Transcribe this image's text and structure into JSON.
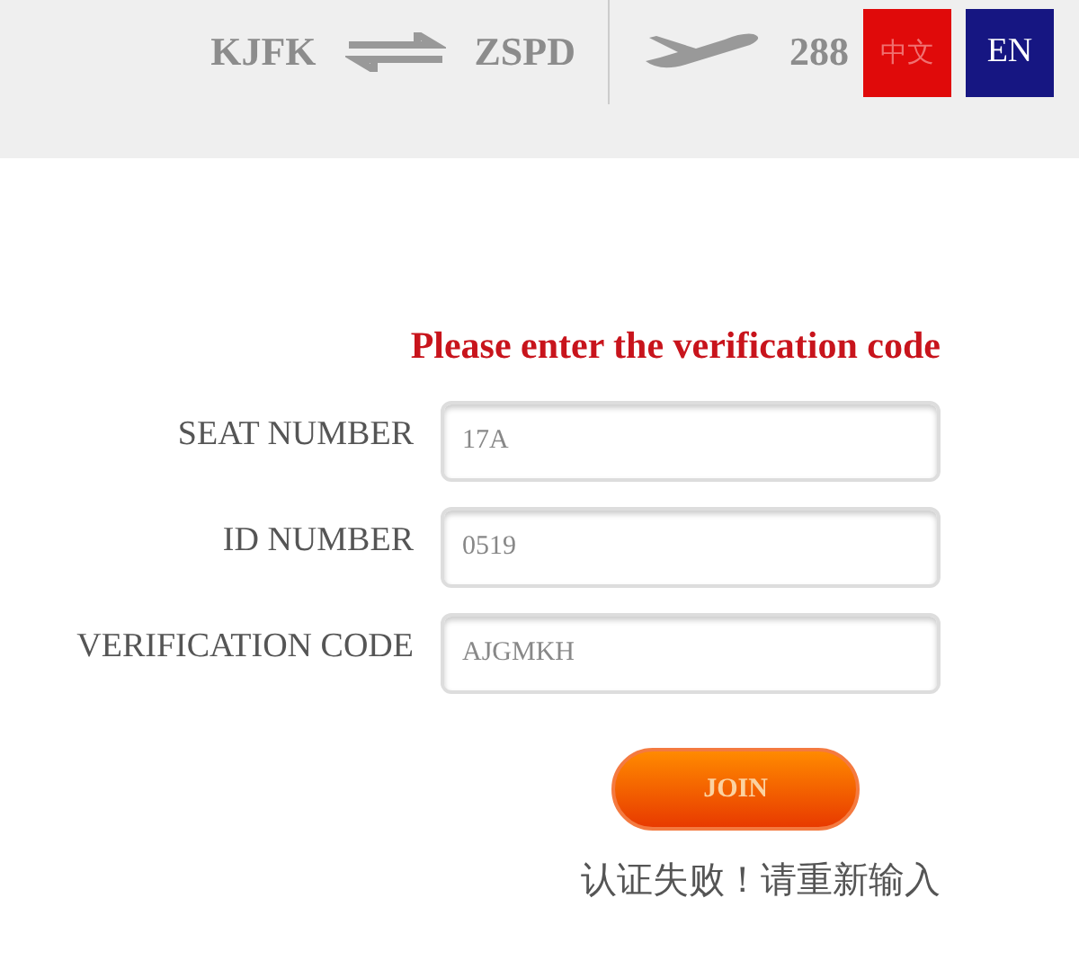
{
  "header": {
    "origin": "KJFK",
    "destination": "ZSPD",
    "flight": "288",
    "languages": [
      {
        "label": "中文",
        "color": "#e00a0a",
        "selected": false
      },
      {
        "label": "EN",
        "color": "#161682",
        "selected": true
      }
    ]
  },
  "form": {
    "title": "Please enter the verification code",
    "fields": [
      {
        "label": "SEAT NUMBER",
        "value": "17A"
      },
      {
        "label": "ID NUMBER",
        "value": "0519"
      },
      {
        "label": "VERIFICATION CODE",
        "value": "AJGMKH"
      }
    ],
    "button": "JOIN",
    "error": "认证失败！请重新输入"
  }
}
